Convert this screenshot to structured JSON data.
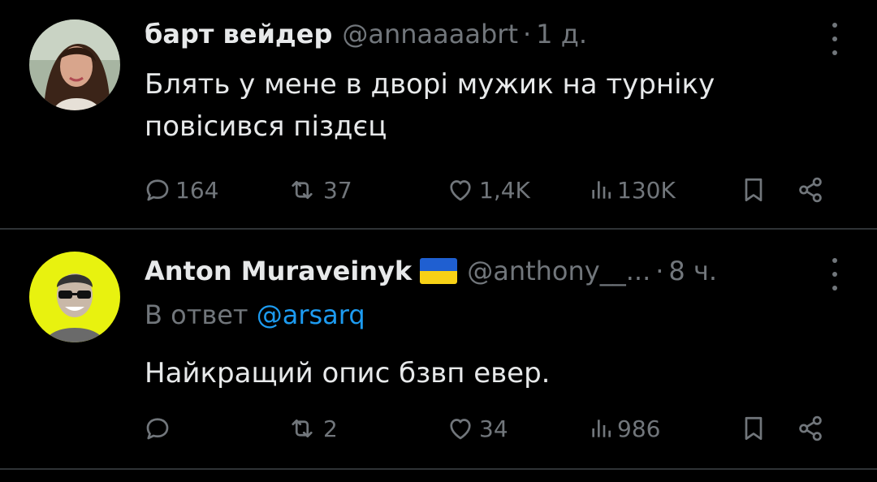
{
  "colors": {
    "background": "#000000",
    "primary_text": "#e7e9ea",
    "secondary_text": "#71767b",
    "link": "#1d9bf0",
    "divider": "#2f3336"
  },
  "tweets": [
    {
      "display_name": "барт вейдер",
      "handle": "@annaaaabrt",
      "separator": "·",
      "time": "1 д.",
      "text_lines": [
        "Блять у мене в дворі мужик на турніку",
        "повісився піздєц"
      ],
      "reply_count": "164",
      "retweet_count": "37",
      "like_count": "1,4K",
      "view_count": "130K"
    },
    {
      "display_name": "Anton Muraveinyk",
      "handle": "@anthony__...",
      "separator": "·",
      "time": "8 ч.",
      "reply_to_prefix": "В ответ",
      "reply_to_handle": "@arsarq",
      "text_lines": [
        "Найкращий опис бзвп евер."
      ],
      "reply_count": "",
      "retweet_count": "2",
      "like_count": "34",
      "view_count": "986"
    }
  ],
  "icons": {
    "reply": "reply-bubble-icon",
    "retweet": "retweet-icon",
    "like": "heart-icon",
    "views": "views-bar-chart-icon",
    "bookmark": "bookmark-icon",
    "share": "share-icon",
    "more": "more-dots-icon",
    "flag": "ukraine-flag-icon"
  }
}
